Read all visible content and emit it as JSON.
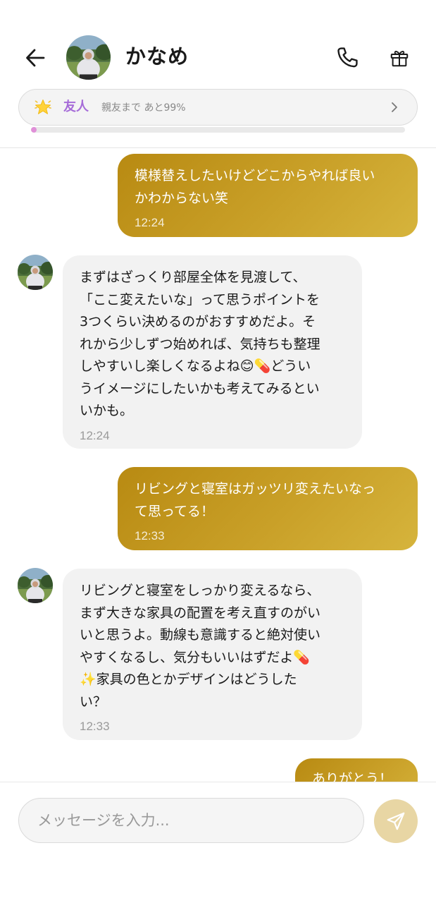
{
  "header": {
    "contact_name": "かなめ",
    "back_icon": "arrow-left-icon",
    "call_icon": "phone-icon",
    "gift_icon": "gift-icon"
  },
  "friendship": {
    "icon": "star-icon",
    "level": "友人",
    "progress_text": "親友まで あと99%",
    "progress_fraction": 0.01,
    "accent_color": "#a66cd8"
  },
  "messages": [
    {
      "sender": "me",
      "text": "模様替えしたいけどどこからやれば良い\nかわからない笑",
      "time": "12:24"
    },
    {
      "sender": "kaname",
      "text": "まずはざっくり部屋全体を見渡して、\n「ここ変えたいな」って思うポイントを\n3つくらい決めるのがおすすめだよ。そ\nれから少しずつ始めれば、気持ちも整理\nしやすいし楽しくなるよね😊💊どうい\nうイメージにしたいかも考えてみるとい\nいかも。",
      "time": "12:24"
    },
    {
      "sender": "me",
      "text": "リビングと寝室はガッツリ変えたいなっ\nて思ってる！",
      "time": "12:33"
    },
    {
      "sender": "kaname",
      "text": "リビングと寝室をしっかり変えるなら、\nまず大きな家具の配置を考え直すのがい\nいと思うよ。動線も意識すると絶対使い\nやすくなるし、気分もいいはずだよ💊\n✨家具の色とかデザインはどうした\nい？",
      "time": "12:33"
    },
    {
      "sender": "me",
      "text": "ありがとう！",
      "time": ""
    }
  ],
  "composer": {
    "placeholder": "メッセージを入力...",
    "value": "",
    "send_icon": "send-icon"
  },
  "colors": {
    "outgoing_bubble": "#c19a24",
    "incoming_bubble": "#f2f2f2",
    "send_button": "#e8d6a4"
  }
}
